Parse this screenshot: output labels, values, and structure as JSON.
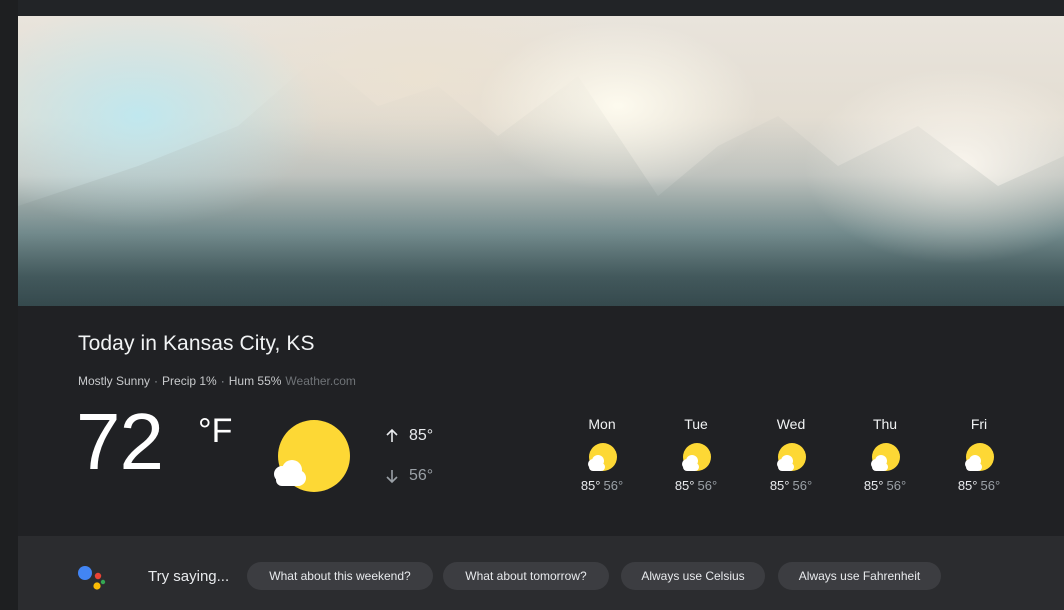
{
  "location_title": "Today in Kansas City, KS",
  "conditions": {
    "summary": "Mostly Sunny",
    "precip": "Precip 1%",
    "humidity": "Hum 55%",
    "source": "Weather.com"
  },
  "current": {
    "temperature": "72",
    "unit": "°F",
    "icon": "partly-sunny-icon",
    "high": "85°",
    "low": "56°"
  },
  "forecast": [
    {
      "day": "Mon",
      "high": "85°",
      "low": "56°",
      "icon": "partly-sunny-icon"
    },
    {
      "day": "Tue",
      "high": "85°",
      "low": "56°",
      "icon": "partly-sunny-icon"
    },
    {
      "day": "Wed",
      "high": "85°",
      "low": "56°",
      "icon": "partly-sunny-icon"
    },
    {
      "day": "Thu",
      "high": "85°",
      "low": "56°",
      "icon": "partly-sunny-icon"
    },
    {
      "day": "Fri",
      "high": "85°",
      "low": "56°",
      "icon": "partly-sunny-icon"
    }
  ],
  "suggestions": {
    "prompt": "Try saying...",
    "chips": [
      "What about this weekend?",
      "What about tomorrow?",
      "Always use Celsius",
      "Always use Fahrenheit"
    ]
  },
  "colors": {
    "panel_bg": "#202124",
    "suggestion_bg": "#2b2c2f",
    "chip_bg": "#3c3d41",
    "sun": "#fdd835",
    "cloud": "#ffffff",
    "assistant_blue": "#4285f4",
    "assistant_red": "#ea4335",
    "assistant_yellow": "#fbbc05",
    "assistant_green": "#34a853"
  }
}
